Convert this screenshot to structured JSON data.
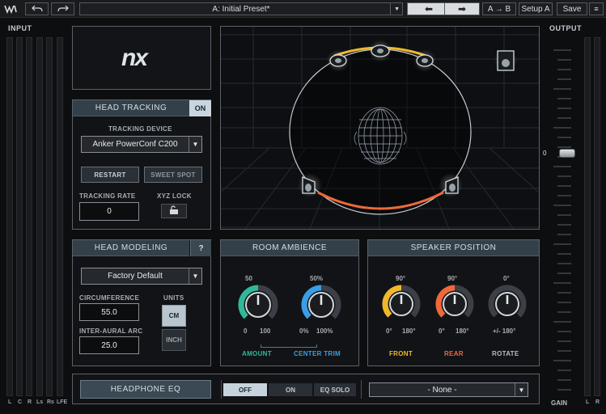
{
  "toolbar": {
    "undo_icon": "undo-icon",
    "redo_icon": "redo-icon",
    "preset_name": "A: Initial Preset*",
    "preset_dropdown_arrow": "▼",
    "prev_label": "⬅",
    "next_label": "➡",
    "ab_label": "A → B",
    "setup_label": "Setup A",
    "save_label": "Save"
  },
  "input": {
    "label": "INPUT",
    "channels": [
      "L",
      "C",
      "R",
      "Ls",
      "Rs",
      "LFE"
    ]
  },
  "output": {
    "label": "OUTPUT",
    "gain_label": "GAIN",
    "gain_value": "0",
    "channels": [
      "L",
      "R"
    ]
  },
  "logo": {
    "text": "nx"
  },
  "head_tracking": {
    "title": "HEAD TRACKING",
    "toggle": "ON",
    "device_label": "TRACKING DEVICE",
    "device_value": "Anker PowerConf C200",
    "restart": "RESTART",
    "sweet_spot": "SWEET SPOT",
    "rate_label": "TRACKING RATE",
    "rate_value": "0",
    "xyz_label": "XYZ LOCK"
  },
  "head_modeling": {
    "title": "HEAD MODELING",
    "help": "?",
    "model_value": "Factory Default",
    "circ_label": "CIRCUMFERENCE",
    "circ_value": "55.0",
    "interaural_label": "INTER-AURAL ARC",
    "interaural_value": "25.0",
    "units_label": "UNITS",
    "unit_cm": "CM",
    "unit_inch": "INCH"
  },
  "room_ambience": {
    "title": "ROOM AMBIENCE",
    "amount": {
      "value": "50",
      "min": "0",
      "max": "100",
      "name": "AMOUNT",
      "level": 0.5,
      "color": "#2fb89a"
    },
    "center_trim": {
      "value": "50%",
      "min": "0%",
      "max": "100%",
      "name": "CENTER TRIM",
      "level": 0.5,
      "color": "#3a9ee6"
    }
  },
  "speaker_position": {
    "title": "SPEAKER POSITION",
    "front": {
      "value": "90°",
      "min": "0°",
      "max": "180°",
      "name": "FRONT",
      "level": 0.5,
      "color": "#f0b929"
    },
    "rear": {
      "value": "90°",
      "min": "0°",
      "max": "180°",
      "name": "REAR",
      "level": 0.5,
      "color": "#f0683a"
    },
    "rotate": {
      "value": "0°",
      "min": "+/- 180°",
      "name": "ROTATE",
      "level": 0.0,
      "color": "#c0c6cc"
    }
  },
  "headphone_eq": {
    "title": "HEADPHONE EQ",
    "off": "OFF",
    "on": "ON",
    "solo": "EQ SOLO",
    "model_value": "- None -"
  },
  "colors": {
    "front_arc": "#f0b929",
    "rear_arc": "#f0683a",
    "panel_title": "#344049"
  }
}
